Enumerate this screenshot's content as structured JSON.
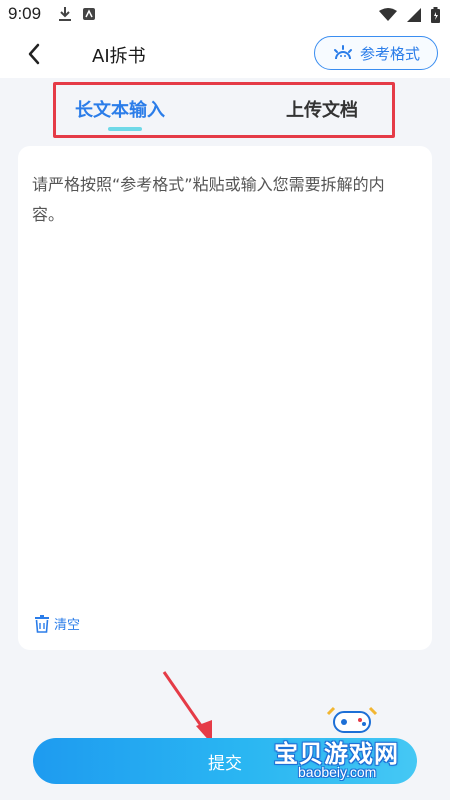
{
  "status_bar": {
    "time": "9:09"
  },
  "header": {
    "title": "AI拆书",
    "ref_format_label": "参考格式"
  },
  "tabs": [
    {
      "label": "长文本输入",
      "active": true
    },
    {
      "label": "上传文档",
      "active": false
    }
  ],
  "editor": {
    "placeholder": "请严格按照“参考格式”粘贴或输入您需要拆解的内容。",
    "clear_label": "清空"
  },
  "submit_label": "提交",
  "watermark": {
    "title": "宝贝游戏网",
    "url": "baobeiy.com"
  },
  "colors": {
    "accent": "#2b7de9",
    "annotation": "#e53b47",
    "tab_underline": "#6fd9e8",
    "background": "#f3f5f9"
  }
}
